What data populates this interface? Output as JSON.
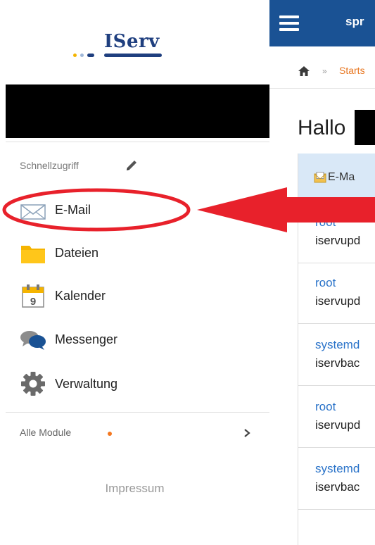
{
  "logo": {
    "text": "IServ"
  },
  "sidebar": {
    "quick_access_title": "Schnellzugriff",
    "items": [
      {
        "label": "E-Mail",
        "icon": "envelope-icon"
      },
      {
        "label": "Dateien",
        "icon": "folder-icon"
      },
      {
        "label": "Kalender",
        "icon": "calendar-icon"
      },
      {
        "label": "Messenger",
        "icon": "chat-bubbles-icon"
      },
      {
        "label": "Verwaltung",
        "icon": "gear-icon"
      }
    ],
    "all_modules_label": "Alle Module",
    "footer_link": "Impressum"
  },
  "calendar_icon_day": "9",
  "topbar": {
    "title": "spr"
  },
  "breadcrumb": {
    "separator": "»",
    "link": "Starts"
  },
  "main": {
    "greeting": "Hallo",
    "mail_panel_title": "E-Ma",
    "mails": [
      {
        "sender": "root",
        "subject": "iservupd"
      },
      {
        "sender": "root",
        "subject": "iservupd"
      },
      {
        "sender": "systemd",
        "subject": "iservbac"
      },
      {
        "sender": "root",
        "subject": "iservupd"
      },
      {
        "sender": "systemd",
        "subject": "iservbac"
      }
    ]
  },
  "colors": {
    "brand_blue": "#1a5294",
    "accent_orange": "#f47820",
    "link_blue": "#2a73c9",
    "annotation_red": "#e8212b"
  }
}
